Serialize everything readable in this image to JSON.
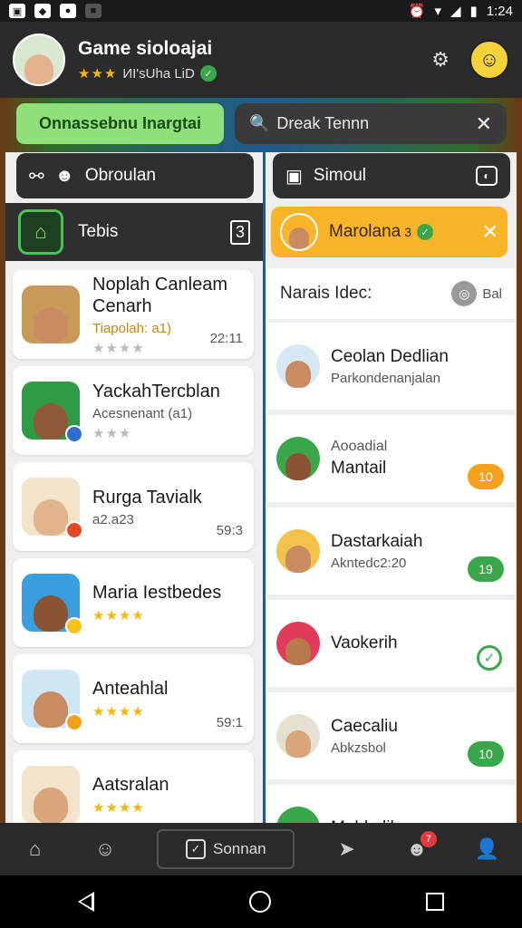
{
  "status": {
    "time": "1:24",
    "battery": "▮",
    "wifi": "▾",
    "signal": "◢"
  },
  "header": {
    "title": "Game sioloajai",
    "subtitle": "ИI'sUha LiD",
    "stars": "★★★"
  },
  "top": {
    "green_button": "Onnassebnu Inargtai",
    "search_value": "Dreak Tennn"
  },
  "left": {
    "header1": "Obroulan",
    "header2": "Tebis",
    "count": "3",
    "items": [
      {
        "name": "Noplah Canleam Cenarh",
        "sub": "Tiapolah: a1)",
        "sub_style": "orange",
        "stars": "★★★★",
        "time": "22:11",
        "skin": "#c98b62",
        "bg": "#c79a5a",
        "badge": ""
      },
      {
        "name": "YackahTercblan",
        "sub": "Acesnenant (a1)",
        "sub_style": "",
        "stars": "★★★",
        "time": "",
        "skin": "#8e5a3a",
        "bg": "#2f9b44",
        "badge": "#2f6fd0"
      },
      {
        "name": "Rurga Tavialk",
        "sub": "a2.a23",
        "sub_style": "",
        "stars": "",
        "time": "59:3",
        "skin": "#e2b38c",
        "bg": "#f2e4c8",
        "badge": "#e24a2a"
      },
      {
        "name": "Maria Iestbedes",
        "sub": "",
        "sub_style": "",
        "stars": "★★★★",
        "time": "",
        "skin": "#8a5434",
        "bg": "#3a9fe0",
        "badge": "#f5c21a"
      },
      {
        "name": "Anteahlal",
        "sub": "",
        "sub_style": "",
        "stars": "★★★★",
        "time": "59:1",
        "skin": "#c98b62",
        "bg": "#cfe6f5",
        "badge": "#f5a21a"
      },
      {
        "name": "Aatsralan",
        "sub": "",
        "sub_style": "",
        "stars": "★★★★",
        "time": "",
        "skin": "#d9a57a",
        "bg": "#f3e2cc",
        "badge": ""
      }
    ]
  },
  "right": {
    "header1": "Simoul",
    "highlight_name": "Marolana",
    "highlight_count": "3",
    "subheader": "Narais Idec:",
    "subheader_right": "Bal",
    "items": [
      {
        "section": "",
        "name": "Ceolan Dedlian",
        "sub": "Parkondenanjalan",
        "skin": "#c98b62",
        "bg": "#d7e8f5",
        "badge": "",
        "badge_color": "",
        "check": false
      },
      {
        "section": "Aooadial",
        "name": "Mantail",
        "sub": "",
        "skin": "#8a5434",
        "bg": "#3aa84a",
        "badge": "10",
        "badge_color": "#f5a21a",
        "check": false
      },
      {
        "section": "",
        "name": "Dastarkaiah",
        "sub": "Akntedc2:20",
        "skin": "#c98b62",
        "bg": "#f2c24a",
        "badge": "19",
        "badge_color": "#3aa84a",
        "check": false
      },
      {
        "section": "",
        "name": "Vaokerih",
        "sub": "",
        "skin": "#b87a4c",
        "bg": "#e23a5a",
        "badge": "",
        "badge_color": "",
        "check": true
      },
      {
        "section": "",
        "name": "Caecaliu",
        "sub": "Abkzsbol",
        "skin": "#d9a57a",
        "bg": "#e6e0d0",
        "badge": "10",
        "badge_color": "#3aa84a",
        "check": false
      },
      {
        "section": "",
        "name": "Mabkelih",
        "sub": "",
        "skin": "#8a5434",
        "bg": "#3aa84a",
        "badge": "",
        "badge_color": "",
        "check": true
      }
    ]
  },
  "bottom_nav": {
    "center_label": "Sonnan",
    "badge": "7"
  },
  "colors": {
    "accent_green": "#8fe07a",
    "highlight_orange": "#f9b42a",
    "header_dark": "#2b2b2b"
  }
}
